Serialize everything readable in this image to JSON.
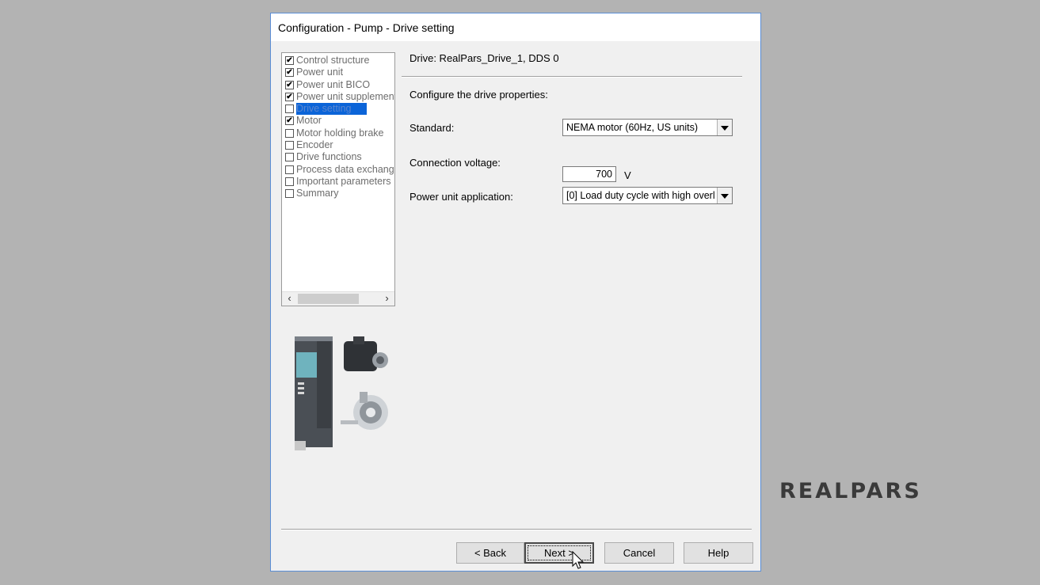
{
  "window": {
    "title": "Configuration - Pump - Drive setting"
  },
  "navigation": {
    "items": [
      {
        "label": "Control structure",
        "checked": true,
        "selected": false
      },
      {
        "label": "Power unit",
        "checked": true,
        "selected": false
      },
      {
        "label": "Power unit BICO",
        "checked": true,
        "selected": false
      },
      {
        "label": "Power unit supplement",
        "checked": true,
        "selected": false
      },
      {
        "label": "Drive setting",
        "checked": false,
        "selected": true
      },
      {
        "label": "Motor",
        "checked": true,
        "selected": false
      },
      {
        "label": "Motor holding brake",
        "checked": false,
        "selected": false
      },
      {
        "label": "Encoder",
        "checked": false,
        "selected": false
      },
      {
        "label": "Drive functions",
        "checked": false,
        "selected": false
      },
      {
        "label": "Process data exchang",
        "checked": false,
        "selected": false
      },
      {
        "label": "Important parameters",
        "checked": false,
        "selected": false
      },
      {
        "label": "Summary",
        "checked": false,
        "selected": false
      }
    ],
    "check_mark": "✔"
  },
  "content": {
    "drive_label": "Drive: RealPars_Drive_1, DDS 0",
    "configure_text": "Configure the drive properties:",
    "standard": {
      "label": "Standard:",
      "value": "NEMA motor (60Hz, US units)"
    },
    "connection_voltage": {
      "label": "Connection voltage:",
      "value": "700",
      "unit": "V"
    },
    "power_unit_application": {
      "label": "Power unit application:",
      "value": "[0] Load duty cycle with high overl"
    }
  },
  "buttons": {
    "back": "< Back",
    "next": "Next >",
    "cancel": "Cancel",
    "help": "Help"
  },
  "logo": {
    "text": "REALPARS"
  },
  "colors": {
    "selection": "#0b64d8",
    "window_border": "#5b8ed6",
    "background": "#b3b3b3"
  }
}
